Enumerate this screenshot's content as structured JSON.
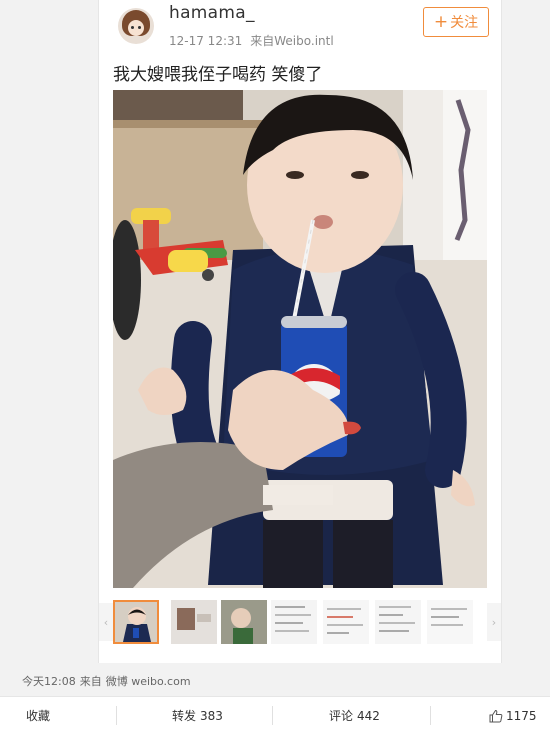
{
  "post": {
    "username": "hamama_",
    "time": "12-17 12:31",
    "source": "来自Weibo.intl",
    "follow_label": "关注",
    "text": "我大嫂喂我侄子喝药 笑傻了",
    "image_alt": "child drinking from a pepsi can with a straw"
  },
  "gallery": {
    "prev_icon": "chevron-left-icon",
    "next_icon": "chevron-right-icon",
    "thumb_count": 7
  },
  "footer": {
    "time": "今天12:08",
    "from": "来自",
    "app": "微博 weibo.com"
  },
  "actions": {
    "favorite_label": "收藏",
    "repost_label": "转发",
    "repost_count": "383",
    "comment_label": "评论",
    "comment_count": "442",
    "like_count": "1175"
  },
  "colors": {
    "accent": "#f08c3c",
    "background": "#f2f2f2"
  }
}
